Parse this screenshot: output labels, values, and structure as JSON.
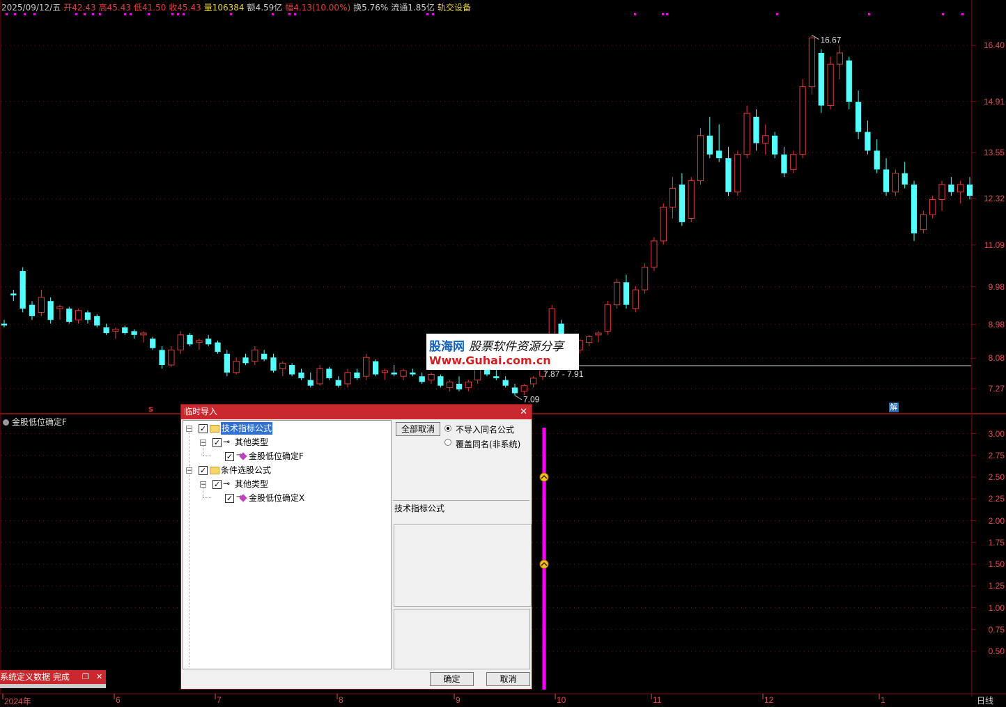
{
  "top_info": {
    "date": "2025/09/12/五",
    "open_label": "开",
    "open": "42.43",
    "high_label": "高",
    "high": "45.43",
    "low_label": "低",
    "low": "41.50",
    "close_label": "收",
    "close": "45.43",
    "volume_label": "量",
    "volume": "106384",
    "amount_label": "额",
    "amount": "4.59亿",
    "change_label": "幅",
    "change": "4.13(10.00%)",
    "turnover_label": "换",
    "turnover": "5.76%",
    "float_label": "流通",
    "float": "1.85亿",
    "sector": "轨交设备"
  },
  "price_axis": [
    "16.40",
    "14.91",
    "13.55",
    "12.32",
    "11.09",
    "9.98",
    "8.98",
    "8.08",
    "7.27"
  ],
  "indicator_axis": [
    "3.00",
    "2.75",
    "2.50",
    "2.25",
    "2.00",
    "1.75",
    "1.50",
    "1.25",
    "1.00",
    "0.75",
    "0.50"
  ],
  "time_axis": [
    "2024年",
    "6",
    "7",
    "8",
    "9",
    "10",
    "11",
    "12",
    "1"
  ],
  "period": "日线",
  "annotations": {
    "high_mark": "16.67",
    "low_mark": "7.09",
    "range_mark": "7.87 - 7.91",
    "jie": "解",
    "s_mark": "s"
  },
  "indicator_title": "金股低位确定F",
  "watermark": {
    "line1_a": "股海网",
    "line1_b": "股票软件资源分享",
    "line2": "Www.Guhai.com.cn"
  },
  "status": {
    "text": "系统定义数据 完成"
  },
  "dialog": {
    "title": "临时导入",
    "tree": {
      "group1": "技术指标公式",
      "group1_sub": "其他类型",
      "group1_item": "金股低位确定F",
      "group2": "条件选股公式",
      "group2_sub": "其他类型",
      "group2_item": "金股低位确定X"
    },
    "cancel_all_label": "全部取消",
    "radio1": "不导入同名公式",
    "radio2": "覆盖同名(非系统)",
    "info_label": "技术指标公式",
    "ok_label": "确定",
    "cancel_label": "取消"
  },
  "colors": {
    "up": "#e03c3c",
    "down": "#54ffff",
    "grid": "#7a1010",
    "signal": "#ff00ff",
    "accent": "#c8282e"
  },
  "chart_data": {
    "type": "candlestick",
    "price_ylim": [
      6.9,
      17.2
    ],
    "high": 16.67,
    "low": 7.09,
    "indicator_ylim": [
      0.3,
      3.1
    ],
    "signal_markers": [
      2.5,
      1.5
    ],
    "candles": [
      [
        9.0,
        9.1,
        8.9,
        8.95
      ],
      [
        9.8,
        9.9,
        9.6,
        9.75
      ],
      [
        10.4,
        10.5,
        9.3,
        9.4
      ],
      [
        9.5,
        9.6,
        9.1,
        9.2
      ],
      [
        9.3,
        9.9,
        9.2,
        9.7
      ],
      [
        9.6,
        9.7,
        9.0,
        9.1
      ],
      [
        9.4,
        9.5,
        9.1,
        9.45
      ],
      [
        9.4,
        9.45,
        9.0,
        9.05
      ],
      [
        9.1,
        9.4,
        9.0,
        9.35
      ],
      [
        9.3,
        9.35,
        9.0,
        9.1
      ],
      [
        9.2,
        9.25,
        8.9,
        8.95
      ],
      [
        8.9,
        9.0,
        8.7,
        8.75
      ],
      [
        8.8,
        8.9,
        8.6,
        8.85
      ],
      [
        8.9,
        8.95,
        8.7,
        8.75
      ],
      [
        8.8,
        8.85,
        8.6,
        8.7
      ],
      [
        8.7,
        8.8,
        8.5,
        8.75
      ],
      [
        8.6,
        8.65,
        8.3,
        8.35
      ],
      [
        8.3,
        8.4,
        7.8,
        7.9
      ],
      [
        7.9,
        8.4,
        7.85,
        8.3
      ],
      [
        8.3,
        8.8,
        8.2,
        8.7
      ],
      [
        8.7,
        8.75,
        8.4,
        8.45
      ],
      [
        8.5,
        8.6,
        8.3,
        8.55
      ],
      [
        8.6,
        8.7,
        8.4,
        8.45
      ],
      [
        8.5,
        8.55,
        8.2,
        8.25
      ],
      [
        8.2,
        8.3,
        7.6,
        7.7
      ],
      [
        7.7,
        8.1,
        7.65,
        8.0
      ],
      [
        8.1,
        8.2,
        7.9,
        7.95
      ],
      [
        8.0,
        8.4,
        7.9,
        8.3
      ],
      [
        8.2,
        8.3,
        8.0,
        8.05
      ],
      [
        8.1,
        8.2,
        7.7,
        7.75
      ],
      [
        7.8,
        8.0,
        7.6,
        7.95
      ],
      [
        7.9,
        7.95,
        7.6,
        7.65
      ],
      [
        7.7,
        7.8,
        7.5,
        7.55
      ],
      [
        7.5,
        7.7,
        7.3,
        7.35
      ],
      [
        7.4,
        7.9,
        7.35,
        7.8
      ],
      [
        7.8,
        7.85,
        7.5,
        7.55
      ],
      [
        7.5,
        7.6,
        7.3,
        7.35
      ],
      [
        7.4,
        7.8,
        7.3,
        7.7
      ],
      [
        7.7,
        7.8,
        7.5,
        7.55
      ],
      [
        7.6,
        8.2,
        7.5,
        8.1
      ],
      [
        8.0,
        8.05,
        7.6,
        7.65
      ],
      [
        7.7,
        7.8,
        7.5,
        7.75
      ],
      [
        7.7,
        7.9,
        7.6,
        7.65
      ],
      [
        7.6,
        7.8,
        7.5,
        7.75
      ],
      [
        7.7,
        7.8,
        7.6,
        7.65
      ],
      [
        7.6,
        7.7,
        7.4,
        7.45
      ],
      [
        7.5,
        7.7,
        7.4,
        7.65
      ],
      [
        7.6,
        7.65,
        7.3,
        7.35
      ],
      [
        7.3,
        7.5,
        7.2,
        7.45
      ],
      [
        7.4,
        7.6,
        7.2,
        7.25
      ],
      [
        7.3,
        7.5,
        7.2,
        7.45
      ],
      [
        7.5,
        7.9,
        7.4,
        7.8
      ],
      [
        7.8,
        7.9,
        7.6,
        7.65
      ],
      [
        7.6,
        7.8,
        7.5,
        7.55
      ],
      [
        7.5,
        7.6,
        7.3,
        7.35
      ],
      [
        7.3,
        7.4,
        7.09,
        7.15
      ],
      [
        7.2,
        7.4,
        7.1,
        7.35
      ],
      [
        7.4,
        7.6,
        7.3,
        7.55
      ],
      [
        7.6,
        8.2,
        7.5,
        8.1
      ],
      [
        8.1,
        9.5,
        8.0,
        9.4
      ],
      [
        9.0,
        9.1,
        8.5,
        8.6
      ],
      [
        8.5,
        8.6,
        8.2,
        8.25
      ],
      [
        8.3,
        8.6,
        8.2,
        8.55
      ],
      [
        8.5,
        8.7,
        8.4,
        8.65
      ],
      [
        8.7,
        8.8,
        8.5,
        8.75
      ],
      [
        8.8,
        9.6,
        8.7,
        9.5
      ],
      [
        9.5,
        10.2,
        9.4,
        10.1
      ],
      [
        10.1,
        10.3,
        9.4,
        9.5
      ],
      [
        9.4,
        10.0,
        9.3,
        9.9
      ],
      [
        9.9,
        10.6,
        9.8,
        10.5
      ],
      [
        10.5,
        11.3,
        10.4,
        11.2
      ],
      [
        11.2,
        12.2,
        11.1,
        12.1
      ],
      [
        12.1,
        12.9,
        11.8,
        12.6
      ],
      [
        12.7,
        13.0,
        11.6,
        11.7
      ],
      [
        11.8,
        12.9,
        11.7,
        12.8
      ],
      [
        12.8,
        14.2,
        12.7,
        14.0
      ],
      [
        14.0,
        14.5,
        13.4,
        13.5
      ],
      [
        13.6,
        14.3,
        13.3,
        13.4
      ],
      [
        13.4,
        13.7,
        12.4,
        12.5
      ],
      [
        12.5,
        13.6,
        12.4,
        13.5
      ],
      [
        13.5,
        14.8,
        13.4,
        14.6
      ],
      [
        14.5,
        14.7,
        13.6,
        13.8
      ],
      [
        13.8,
        14.3,
        13.5,
        14.0
      ],
      [
        14.0,
        14.1,
        13.4,
        13.5
      ],
      [
        13.5,
        13.7,
        12.9,
        13.0
      ],
      [
        13.1,
        13.6,
        13.0,
        13.5
      ],
      [
        13.5,
        15.5,
        13.4,
        15.3
      ],
      [
        15.3,
        16.67,
        15.1,
        16.6
      ],
      [
        16.2,
        16.3,
        14.6,
        14.8
      ],
      [
        14.8,
        16.1,
        14.7,
        15.9
      ],
      [
        15.9,
        16.4,
        15.5,
        16.2
      ],
      [
        16.0,
        16.1,
        14.7,
        14.9
      ],
      [
        14.9,
        15.2,
        13.9,
        14.1
      ],
      [
        14.1,
        14.4,
        13.5,
        13.6
      ],
      [
        13.6,
        13.9,
        13.0,
        13.1
      ],
      [
        13.1,
        13.4,
        12.4,
        12.5
      ],
      [
        12.5,
        13.1,
        12.4,
        13.0
      ],
      [
        13.0,
        13.3,
        12.6,
        12.7
      ],
      [
        12.7,
        12.8,
        11.2,
        11.4
      ],
      [
        11.5,
        12.0,
        11.4,
        11.9
      ],
      [
        11.9,
        12.4,
        11.8,
        12.3
      ],
      [
        12.3,
        12.8,
        12.0,
        12.7
      ],
      [
        12.7,
        12.9,
        12.4,
        12.5
      ],
      [
        12.5,
        12.8,
        12.2,
        12.7
      ],
      [
        12.7,
        12.9,
        12.3,
        12.4
      ]
    ]
  }
}
